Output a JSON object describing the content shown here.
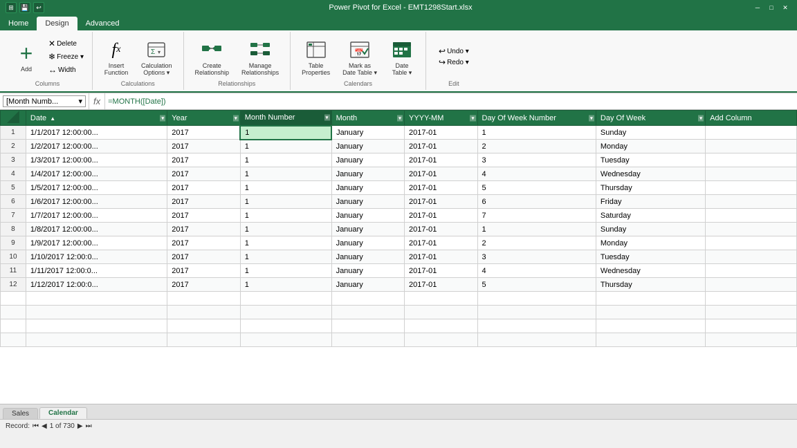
{
  "titleBar": {
    "icons": [
      "⊞",
      "💾",
      "↩"
    ],
    "title": "Power Pivot for Excel - EMT1298Start.xlsx",
    "controls": [
      "─",
      "□",
      "✕"
    ]
  },
  "ribbon": {
    "tabs": [
      "Home",
      "Design",
      "Advanced"
    ],
    "activeTab": "Design",
    "groups": [
      {
        "label": "Columns",
        "items": [
          {
            "type": "large",
            "icon": "⊕",
            "label": "Add"
          },
          {
            "type": "col",
            "items": [
              {
                "icon": "✕",
                "label": "Delete"
              },
              {
                "icon": "❄",
                "label": "Freeze ▾"
              },
              {
                "icon": "↔",
                "label": "Width"
              }
            ]
          }
        ]
      },
      {
        "label": "Calculations",
        "items": [
          {
            "type": "large",
            "icon": "𝑓",
            "label": "Insert\nFunction"
          },
          {
            "type": "large",
            "icon": "⚙",
            "label": "Calculation\nOptions ▾"
          }
        ]
      },
      {
        "label": "Relationships",
        "items": [
          {
            "type": "large",
            "icon": "🔗",
            "label": "Create\nRelationship"
          },
          {
            "type": "large",
            "icon": "🔗",
            "label": "Manage\nRelationships"
          }
        ]
      },
      {
        "label": "Calendars",
        "items": [
          {
            "type": "large",
            "icon": "📅",
            "label": "Table\nProperties"
          },
          {
            "type": "large",
            "icon": "📅",
            "label": "Mark as\nDate Table ▾"
          },
          {
            "type": "large",
            "icon": "📅",
            "label": "Date\nTable ▾"
          }
        ]
      },
      {
        "label": "Edit",
        "items": [
          {
            "type": "undo",
            "items": [
              {
                "label": "Undo ▾"
              },
              {
                "label": "Redo ▾"
              }
            ]
          }
        ]
      }
    ]
  },
  "formulaBar": {
    "nameBox": "[Month Numb...",
    "fx": "fx",
    "formula": "=MONTH([Date])"
  },
  "tableHeaders": [
    {
      "label": "Date",
      "width": 155
    },
    {
      "label": "Year",
      "width": 55
    },
    {
      "label": "Month Number",
      "width": 100,
      "selected": true
    },
    {
      "label": "Month",
      "width": 80
    },
    {
      "label": "YYYY-MM",
      "width": 80
    },
    {
      "label": "Day Of Week Number",
      "width": 130
    },
    {
      "label": "Day Of Week",
      "width": 120
    },
    {
      "label": "Add Column",
      "width": 100,
      "addCol": true
    }
  ],
  "tableRows": [
    {
      "row": 1,
      "date": "1/1/2017 12:00:00...",
      "year": 2017,
      "monthNum": 1,
      "month": "January",
      "yyyymm": "2017-01",
      "dowNum": 1,
      "dow": "Sunday"
    },
    {
      "row": 2,
      "date": "1/2/2017 12:00:00...",
      "year": 2017,
      "monthNum": 1,
      "month": "January",
      "yyyymm": "2017-01",
      "dowNum": 2,
      "dow": "Monday"
    },
    {
      "row": 3,
      "date": "1/3/2017 12:00:00...",
      "year": 2017,
      "monthNum": 1,
      "month": "January",
      "yyyymm": "2017-01",
      "dowNum": 3,
      "dow": "Tuesday"
    },
    {
      "row": 4,
      "date": "1/4/2017 12:00:00...",
      "year": 2017,
      "monthNum": 1,
      "month": "January",
      "yyyymm": "2017-01",
      "dowNum": 4,
      "dow": "Wednesday"
    },
    {
      "row": 5,
      "date": "1/5/2017 12:00:00...",
      "year": 2017,
      "monthNum": 1,
      "month": "January",
      "yyyymm": "2017-01",
      "dowNum": 5,
      "dow": "Thursday"
    },
    {
      "row": 6,
      "date": "1/6/2017 12:00:00...",
      "year": 2017,
      "monthNum": 1,
      "month": "January",
      "yyyymm": "2017-01",
      "dowNum": 6,
      "dow": "Friday"
    },
    {
      "row": 7,
      "date": "1/7/2017 12:00:00...",
      "year": 2017,
      "monthNum": 1,
      "month": "January",
      "yyyymm": "2017-01",
      "dowNum": 7,
      "dow": "Saturday"
    },
    {
      "row": 8,
      "date": "1/8/2017 12:00:00...",
      "year": 2017,
      "monthNum": 1,
      "month": "January",
      "yyyymm": "2017-01",
      "dowNum": 1,
      "dow": "Sunday"
    },
    {
      "row": 9,
      "date": "1/9/2017 12:00:00...",
      "year": 2017,
      "monthNum": 1,
      "month": "January",
      "yyyymm": "2017-01",
      "dowNum": 2,
      "dow": "Monday"
    },
    {
      "row": 10,
      "date": "1/10/2017 12:00:0...",
      "year": 2017,
      "monthNum": 1,
      "month": "January",
      "yyyymm": "2017-01",
      "dowNum": 3,
      "dow": "Tuesday"
    },
    {
      "row": 11,
      "date": "1/11/2017 12:00:0...",
      "year": 2017,
      "monthNum": 1,
      "month": "January",
      "yyyymm": "2017-01",
      "dowNum": 4,
      "dow": "Wednesday"
    },
    {
      "row": 12,
      "date": "1/12/2017 12:00:0...",
      "year": 2017,
      "monthNum": 1,
      "month": "January",
      "yyyymm": "2017-01",
      "dowNum": 5,
      "dow": "Thursday"
    }
  ],
  "sheetTabs": [
    {
      "label": "Sales",
      "active": false
    },
    {
      "label": "Calendar",
      "active": true
    }
  ],
  "statusBar": {
    "label": "Record:",
    "current": "1 of 730",
    "navButtons": [
      "⏮",
      "◀",
      "▶",
      "⏭"
    ]
  },
  "colors": {
    "green": "#217346",
    "darkGreen": "#1a5c38",
    "selectedCell": "#c6efce"
  }
}
